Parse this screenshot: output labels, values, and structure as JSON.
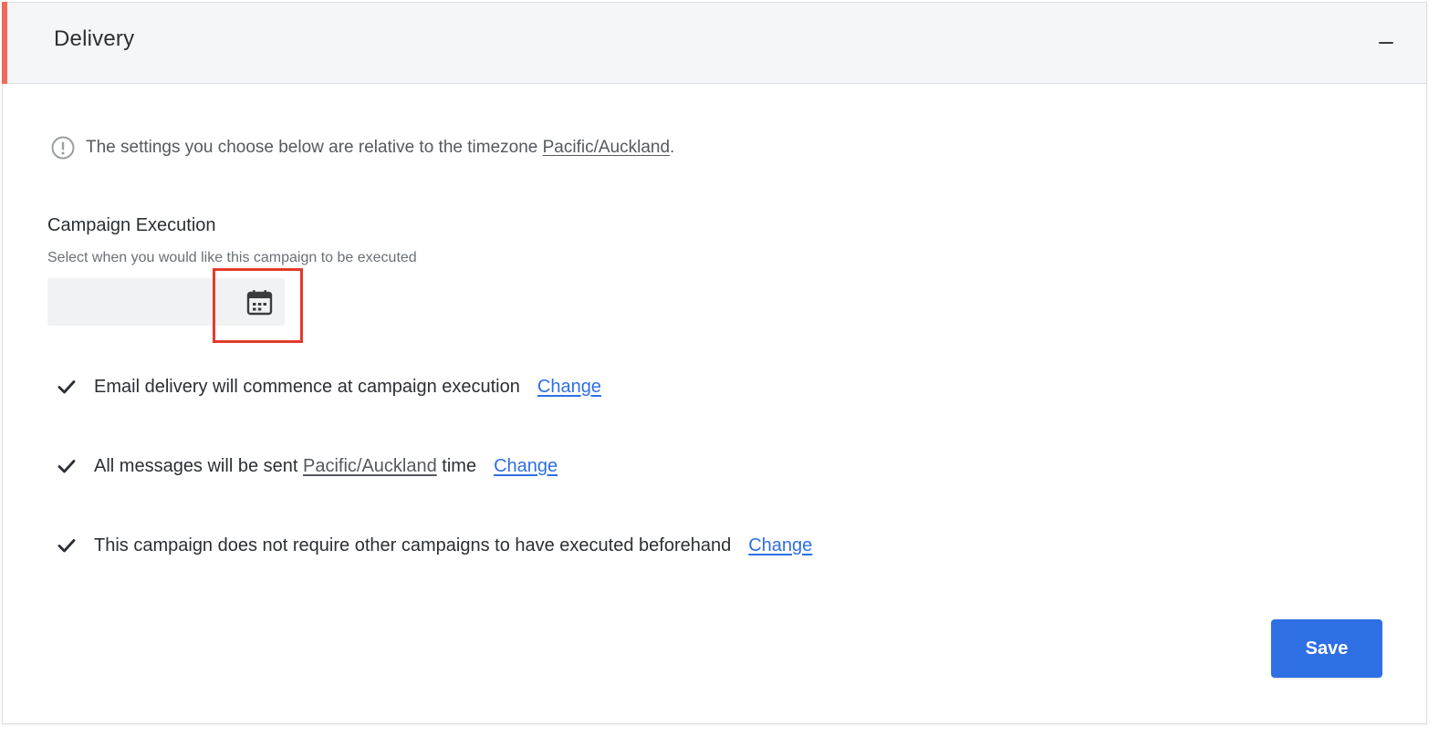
{
  "panel": {
    "title": "Delivery",
    "accent_color": "#ef6b58",
    "collapse_icon": "minus-icon"
  },
  "timezone_notice": {
    "icon": "info-circle-icon",
    "text_before": "The settings you choose below are relative to the timezone ",
    "timezone": "Pacific/Auckland",
    "text_after": "."
  },
  "campaign_execution": {
    "title": "Campaign Execution",
    "description": "Select when you would like this campaign to be executed",
    "date_value": "",
    "calendar_icon": "calendar-icon"
  },
  "rules": [
    {
      "text": "Email delivery will commence at campaign execution",
      "change_label": "Change"
    },
    {
      "text_before": "All messages will be sent ",
      "timezone": "Pacific/Auckland",
      "text_after": " time",
      "change_label": "Change"
    },
    {
      "text": "This campaign does not require other campaigns to have executed beforehand",
      "change_label": "Change"
    }
  ],
  "actions": {
    "save_label": "Save",
    "primary_color": "#2f6fe4"
  },
  "highlight_color": "#e23b2a"
}
